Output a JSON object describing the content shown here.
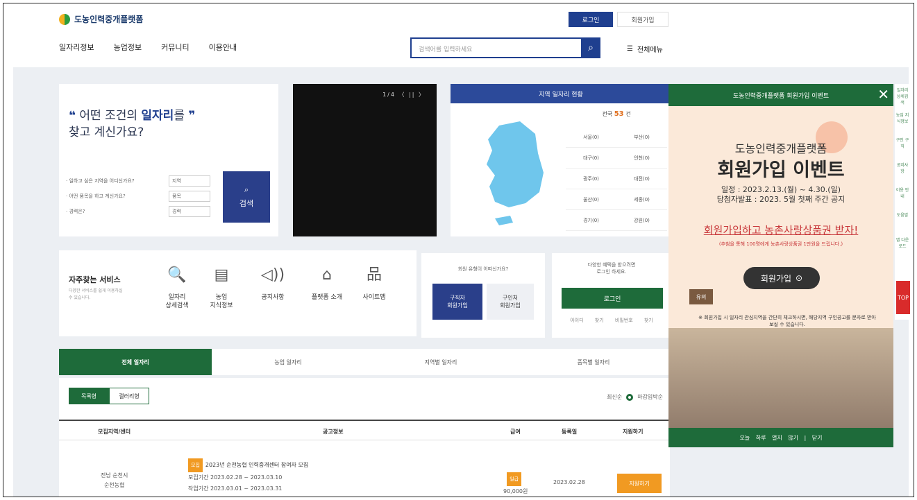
{
  "header": {
    "logo_text": "도농인력중개플랫폼",
    "login": "로그인",
    "join": "회원가입",
    "nav": [
      "일자리정보",
      "농업정보",
      "커뮤니티",
      "이용안내"
    ],
    "search_placeholder": "검색어를 입력하세요",
    "all_menu": "전체메뉴"
  },
  "quick_search": {
    "title_line1_pre": "어떤 조건의 ",
    "title_highlight": "일자리",
    "title_line1_post": "를",
    "title_line2": "찾고 계신가요?",
    "rows": [
      {
        "label": "· 일하고 싶은 지역을 어디신가요?",
        "value": "지역"
      },
      {
        "label": "· 어떤 품목을 하고 계신가요?",
        "value": "품목"
      },
      {
        "label": "· 경력은?",
        "value": "경력"
      }
    ],
    "button": "검색"
  },
  "video": {
    "counter": "1/4",
    "controls": "〈 || 〉"
  },
  "region": {
    "title": "지역 일자리 현황",
    "total_label": "전국",
    "total_value": "53",
    "total_unit": "건",
    "cells": [
      "서울(0)",
      "부산(0)",
      "대구(0)",
      "인천(0)",
      "광주(0)",
      "대전(0)",
      "울산(0)",
      "세종(0)",
      "경기(0)",
      "강원(0)"
    ]
  },
  "services": {
    "title": "자주찾는 서비스",
    "desc": "다양한 서비스를 쉽게 이용하실 수 있습니다.",
    "items": [
      {
        "label": "일자리\n상세검색",
        "icon": "search-doc-icon"
      },
      {
        "label": "농업\n지식정보",
        "icon": "book-icon"
      },
      {
        "label": "공지사항",
        "icon": "megaphone-icon"
      },
      {
        "label": "플랫폼 소개",
        "icon": "building-icon"
      },
      {
        "label": "사이트맵",
        "icon": "sitemap-icon"
      }
    ]
  },
  "member_select": {
    "title": "회원 유형이 어떠신가요?",
    "seeker": "구직자\n회원가입",
    "employer": "구인처\n회원가입"
  },
  "login_box": {
    "text": "다양한 혜택을 받으려면\n로그인 하세요.",
    "button": "로그인",
    "links": "아이디 찾기 비밀번호 찾기"
  },
  "tabs": [
    "전체 일자리",
    "농업 일자리",
    "지역별 일자리",
    "품목별 일자리"
  ],
  "list": {
    "view_list": "목록형",
    "view_card": "갤러리형",
    "sort_latest": "최신순",
    "sort_deadline": "마감임박순",
    "headers": [
      "모집지역/센터",
      "공고정보",
      "급여",
      "등록일",
      "지원하기"
    ],
    "rows": [
      {
        "region": "전남 순천시",
        "center": "순천농협",
        "badge": "모집",
        "title": "2023년 순천농협 인력중개센터 참여자 모집",
        "period1": "모집기간  2023.02.28 ~ 2023.03.10",
        "period2": "작업기간  2023.03.01 ~ 2023.03.31",
        "pay_type": "일급",
        "pay": "90,000원",
        "date": "2023.02.28",
        "apply": "지원하기"
      }
    ]
  },
  "popup": {
    "header": "도농인력중개플랫폼 회원가입 이벤트",
    "sub": "도농인력중개플랫폼",
    "title": "회원가입 이벤트",
    "date1": "일정 : 2023.2.13.(월) ~ 4.30.(일)",
    "date2": "당첨자발표 : 2023. 5월 첫째 주간 공지",
    "red": "회원가입하고 농촌사랑상품권 받자!",
    "small": "(추첨을 통해 100명에게 농촌사랑상품권 1만원을 드립니다.)",
    "join_btn": "회원가입",
    "tag": "유의",
    "note": "※ 회원가입 시 일자리 관심지역을 간단히 체크하시면, 해당지역 구인공고를 문자로 받아보실 수 있습니다.",
    "footer": "오늘 하루 열지 않기 | 닫기"
  },
  "quick_menu": [
    "일자리 상세검색",
    "농업 지식정보",
    "구인 구직",
    "공지사항",
    "이용 안내",
    "도움말",
    "앱 다운로드"
  ],
  "top_btn": "TOP"
}
